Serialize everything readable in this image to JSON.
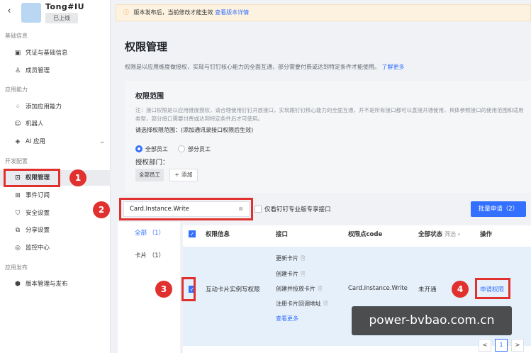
{
  "app": {
    "name": "Tong#IU",
    "status": "已上线"
  },
  "sidebar": {
    "sections": [
      {
        "title": "基础信息",
        "items": [
          {
            "label": "凭证与基础信息",
            "icon": "credential-icon"
          },
          {
            "label": "成员管理",
            "icon": "member-icon"
          }
        ]
      },
      {
        "title": "应用能力",
        "items": [
          {
            "label": "添加应用能力",
            "icon": "add-capability-icon"
          },
          {
            "label": "机器人",
            "icon": "robot-icon"
          },
          {
            "label": "AI 应用",
            "icon": "ai-icon"
          }
        ]
      },
      {
        "title": "开发配置",
        "items": [
          {
            "label": "权限管理",
            "icon": "permission-icon"
          },
          {
            "label": "事件订阅",
            "icon": "event-icon"
          },
          {
            "label": "安全设置",
            "icon": "security-icon"
          },
          {
            "label": "分享设置",
            "icon": "share-icon"
          },
          {
            "label": "监控中心",
            "icon": "monitor-icon"
          }
        ]
      },
      {
        "title": "应用发布",
        "items": [
          {
            "label": "版本管理与发布",
            "icon": "version-icon"
          }
        ]
      }
    ]
  },
  "banner": {
    "text": "版本发布后，当前修改才能生效",
    "link": "查看版本详情"
  },
  "page": {
    "title": "权限管理",
    "desc": "权限是以应用维度做授权，实现与钉钉核心能力的全面互通，部分需要付费或达到特定条件才能使用。",
    "desc_link": "了解更多"
  },
  "scope": {
    "title": "权限范围",
    "note": "注：接口权限是以应用维度授权，请合理使用钉钉开放接口，实现跟钉钉核心能力的全面互通，并不是所有接口都可以直接开通使用，具体参照接口的使用范围和适用类型，部分接口需要付费或达到特定条件后才可使用。",
    "pick_label": "请选择权限范围：(添加通讯录接口权限后生效)",
    "radio_all": "全部员工",
    "radio_part": "部分员工",
    "dept_label": "授权部门：",
    "dept_tag": "全部员工",
    "add_label": "+ 添加"
  },
  "search": {
    "value": "Card.Instance.Write",
    "clear": "⊗"
  },
  "filter_label": "仅看钉钉专业版专享接口",
  "batch_label": "批量申请（2）",
  "categories": [
    {
      "label": "全部 （1）"
    },
    {
      "label": "卡片 （1）"
    }
  ],
  "table": {
    "headers": {
      "info": "权限信息",
      "iface": "接口",
      "code": "权限点code",
      "status": "全部状态",
      "filter": "筛选",
      "op": "操作"
    },
    "row": {
      "info": "互动卡片实例写权限",
      "interfaces": [
        "更新卡片",
        "创建卡片",
        "创建并投放卡片",
        "注册卡片回调地址"
      ],
      "more": "查看更多",
      "code": "Card.Instance.Write",
      "status": "未开通",
      "op": "申请权限"
    }
  },
  "badges": [
    "1",
    "2",
    "3",
    "4"
  ],
  "watermark": "power-bvbao.com.cn",
  "pagination": {
    "prev": "<",
    "current": "1",
    "next": ">"
  }
}
